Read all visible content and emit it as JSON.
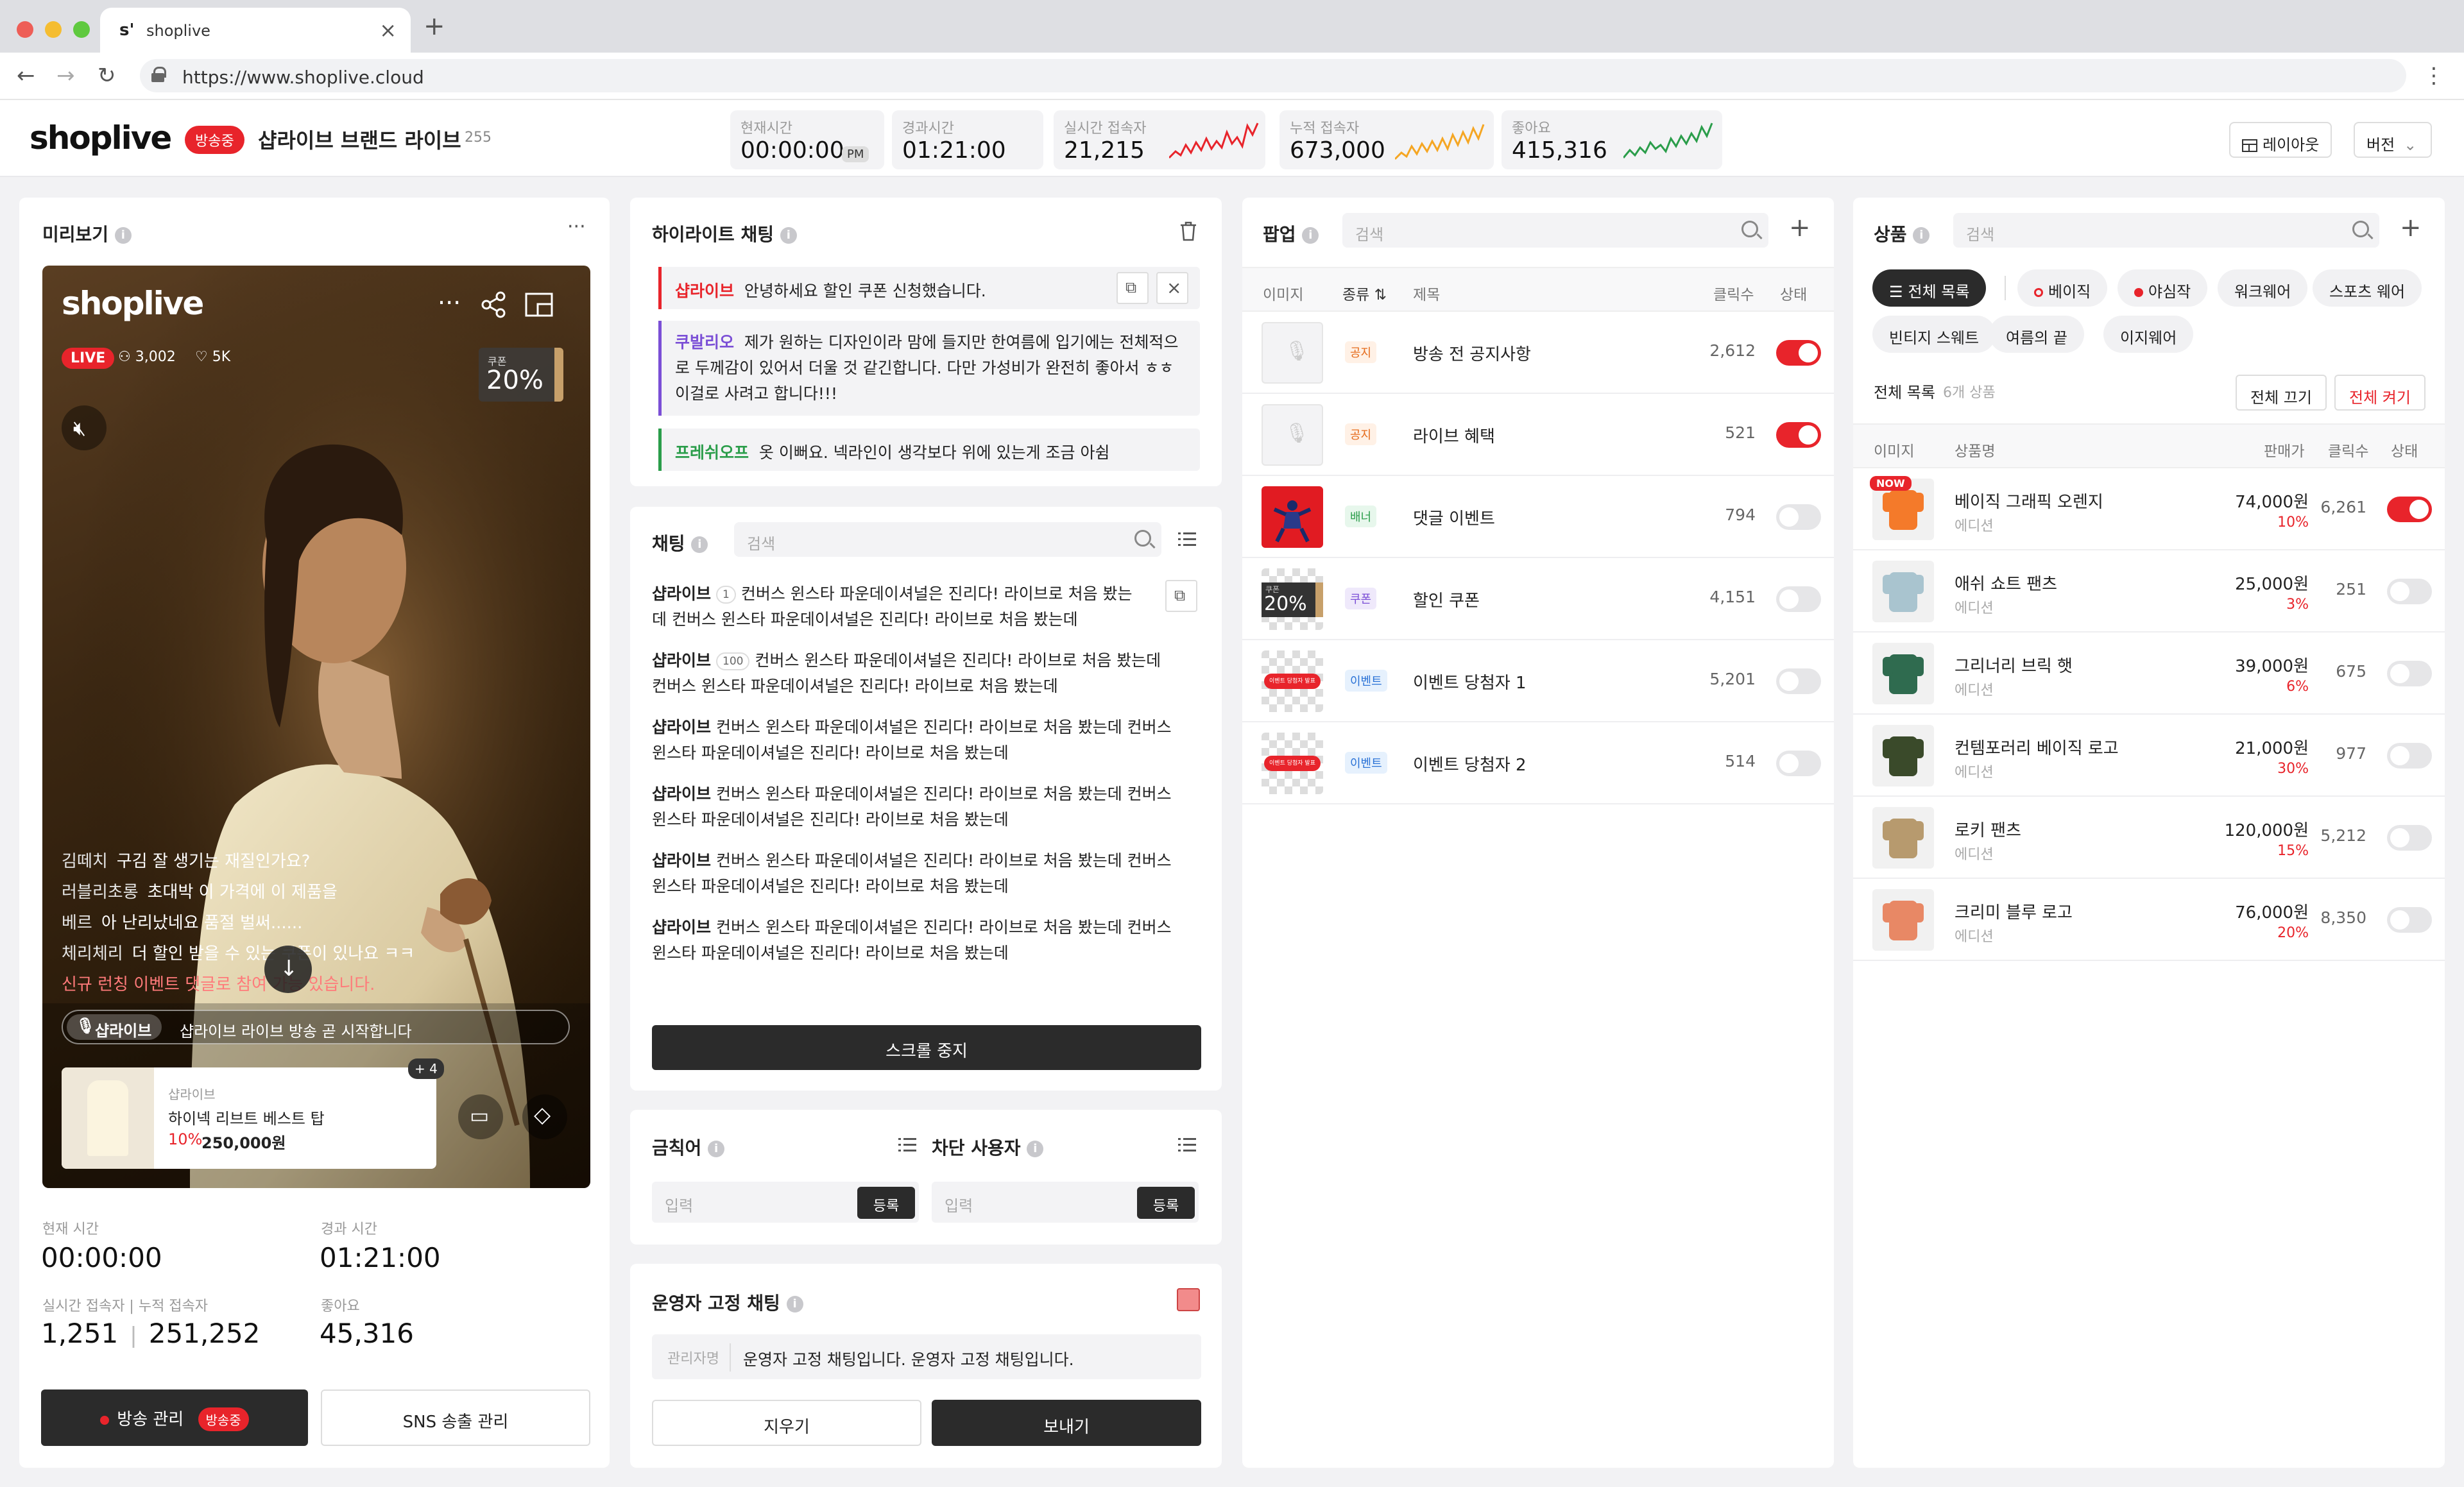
{
  "browser": {
    "tab_title": "shoplive",
    "favicon": "s'",
    "url": "https://www.shoplive.cloud"
  },
  "header": {
    "logo": "shoplive",
    "live_badge": "방송중",
    "title": "샵라이브 브랜드 라이브",
    "view_count": "255",
    "stats": [
      {
        "label": "현재시간",
        "value": "00:00:00",
        "suffix": "PM"
      },
      {
        "label": "경과시간",
        "value": "01:21:00"
      },
      {
        "label": "실시간 접속자",
        "value": "21,215"
      },
      {
        "label": "누적 접속자",
        "value": "673,000"
      },
      {
        "label": "좋아요",
        "value": "415,316"
      }
    ],
    "layout_button": "레이아웃",
    "version_button": "버전",
    "colors": {
      "red": "#e8242b",
      "orange": "#f5a623",
      "green": "#2a9d4a"
    }
  },
  "preview": {
    "title": "미리보기",
    "video": {
      "logo": "shoplive",
      "live": "LIVE",
      "viewers": "3,002",
      "likes": "5K",
      "coupon_label": "쿠폰",
      "coupon_value": "20%",
      "chats": [
        {
          "name": "김떼치",
          "text": "구김 잘 생기는 재질인가요?"
        },
        {
          "name": "러블리초롱",
          "text": "초대박 이 가격에 이 제품을"
        },
        {
          "name": "베르",
          "text": "아 난리났네요 품절 벌써......"
        },
        {
          "name": "체리체리",
          "text": "더 할인 받을 수 있는 쿠폰이 있나요 ㅋㅋ"
        },
        {
          "name": "",
          "text": "신규 런칭 이벤트 댓글로 참여 가능 있습니다."
        }
      ],
      "pinned_name": "샵라이브",
      "pinned_text": "샵라이브 라이브 방송 곧 시작합니다",
      "product_brand": "샵라이브",
      "product_name": "하이넥 리브트 베스트 탑",
      "product_discount": "10%",
      "product_price": "250,000원",
      "more_count": "+ 4"
    },
    "stats": {
      "current_label": "현재 시간",
      "current_value": "00:00:00",
      "elapsed_label": "경과 시간",
      "elapsed_value": "01:21:00",
      "viewers_label": "실시간 접속자 | 누적 접속자",
      "viewers_value": "1,251",
      "total_value": "251,252",
      "likes_label": "좋아요",
      "likes_value": "45,316"
    },
    "broadcast_button": "방송 관리",
    "broadcast_badge": "방송중",
    "sns_button": "SNS 송출 관리"
  },
  "highlight": {
    "title": "하이라이트 채팅",
    "items": [
      {
        "name": "샵라이브",
        "text": "안녕하세요 할인 쿠폰 신청했습니다.",
        "color": "#e8242b"
      },
      {
        "name": "쿠발리오",
        "text": "제가 원하는 디자인이라 맘에 들지만 한여름에 입기에는 전체적으로 두께감이 있어서 더울 것 같긴합니다. 다만 가성비가 완전히 좋아서 ㅎㅎ 이걸로 사려고 합니다!!!",
        "color": "#7b4fd6"
      },
      {
        "name": "프레쉬오프",
        "text": "옷 이뻐요. 넥라인이 생각보다 위에 있는게 조금 아쉼",
        "color": "#2a9d4a"
      }
    ]
  },
  "chat": {
    "title": "채팅",
    "search_placeholder": "검색",
    "messages": [
      {
        "name": "샵라이브",
        "count": "1",
        "text": "컨버스 윈스타 파운데이셔널은 진리다! 라이브로 처음 봤는데 컨버스 윈스타 파운데이셔널은 진리다! 라이브로 처음 봤는데"
      },
      {
        "name": "샵라이브",
        "count": "100",
        "text": "컨버스 윈스타 파운데이셔널은 진리다! 라이브로 처음 봤는데 컨버스 윈스타 파운데이셔널은 진리다! 라이브로 처음 봤는데"
      },
      {
        "name": "샵라이브",
        "count": "",
        "text": "컨버스 윈스타 파운데이셔널은 진리다! 라이브로 처음 봤는데 컨버스 윈스타 파운데이셔널은 진리다! 라이브로 처음 봤는데"
      },
      {
        "name": "샵라이브",
        "count": "",
        "text": "컨버스 윈스타 파운데이셔널은 진리다! 라이브로 처음 봤는데 컨버스 윈스타 파운데이셔널은 진리다! 라이브로 처음 봤는데"
      },
      {
        "name": "샵라이브",
        "count": "",
        "text": "컨버스 윈스타 파운데이셔널은 진리다! 라이브로 처음 봤는데 컨버스 윈스타 파운데이셔널은 진리다! 라이브로 처음 봤는데"
      },
      {
        "name": "샵라이브",
        "count": "",
        "text": "컨버스 윈스타 파운데이셔널은 진리다! 라이브로 처음 봤는데 컨버스 윈스타 파운데이셔널은 진리다! 라이브로 처음 봤는데"
      }
    ],
    "stop_scroll": "스크롤 중지"
  },
  "banned": {
    "title": "금칙어",
    "placeholder": "입력",
    "button": "등록",
    "blocked_title": "차단 사용자",
    "blocked_placeholder": "입력",
    "blocked_button": "등록"
  },
  "admin_chat": {
    "title": "운영자 고정 채팅",
    "color": "#f28b8b",
    "prefix": "관리자명",
    "text": "운영자 고정 채팅입니다. 운영자 고정 채팅입니다.",
    "clear_button": "지우기",
    "send_button": "보내기"
  },
  "popup": {
    "title": "팝업",
    "search_placeholder": "검색",
    "columns": {
      "image": "이미지",
      "type": "종류",
      "title": "제목",
      "clicks": "클릭수",
      "status": "상태"
    },
    "rows": [
      {
        "type": "공지",
        "title": "방송 전 공지사항",
        "clicks": "2,612",
        "on": true,
        "thumb": "mic"
      },
      {
        "type": "공지",
        "title": "라이브 혜택",
        "clicks": "521",
        "on": true,
        "thumb": "mic"
      },
      {
        "type": "배너",
        "title": "댓글 이벤트",
        "clicks": "794",
        "on": false,
        "thumb": "banner"
      },
      {
        "type": "쿠폰",
        "title": "할인 쿠폰",
        "clicks": "4,151",
        "on": false,
        "thumb": "coupon",
        "thumb_label": "쿠폰",
        "thumb_value": "20%"
      },
      {
        "type": "이벤트",
        "title": "이벤트 당첨자 1",
        "clicks": "5,201",
        "on": false,
        "thumb": "event",
        "thumb_label": "이벤트 당첨자 발표"
      },
      {
        "type": "이벤트",
        "title": "이벤트 당첨자 2",
        "clicks": "514",
        "on": false,
        "thumb": "event",
        "thumb_label": "이벤트 당첨자 발표"
      }
    ]
  },
  "products": {
    "title": "상품",
    "search_placeholder": "검색",
    "chips": [
      "전체 목록",
      "베이직",
      "야심작",
      "워크웨어",
      "스포츠 웨어",
      "빈티지 스웨트",
      "여름의 끝",
      "이지웨어"
    ],
    "list_label": "전체 목록",
    "list_count": "6개 상품",
    "all_off": "전체 끄기",
    "all_on": "전체 켜기",
    "columns": {
      "image": "이미지",
      "name": "상품명",
      "price": "판매가",
      "clicks": "클릭수",
      "status": "상태"
    },
    "now_badge": "NOW",
    "rows": [
      {
        "name": "베이직 그래픽 오렌지",
        "brand": "에디션",
        "price": "74,000원",
        "discount": "10%",
        "clicks": "6,261",
        "on": true,
        "color": "#f47a2a"
      },
      {
        "name": "애쉬 쇼트 팬츠",
        "brand": "에디션",
        "price": "25,000원",
        "discount": "3%",
        "clicks": "251",
        "on": false,
        "color": "#a9c4cf"
      },
      {
        "name": "그리너리 브릭 햇",
        "brand": "에디션",
        "price": "39,000원",
        "discount": "6%",
        "clicks": "675",
        "on": false,
        "color": "#2f6b4f"
      },
      {
        "name": "컨템포러리 베이직 로고",
        "brand": "에디션",
        "price": "21,000원",
        "discount": "30%",
        "clicks": "977",
        "on": false,
        "color": "#3a4a2a"
      },
      {
        "name": "로키 팬츠",
        "brand": "에디션",
        "price": "120,000원",
        "discount": "15%",
        "clicks": "5,212",
        "on": false,
        "color": "#b79a6e"
      },
      {
        "name": "크리미 블루 로고",
        "brand": "에디션",
        "price": "76,000원",
        "discount": "20%",
        "clicks": "8,350",
        "on": false,
        "color": "#e88865"
      }
    ]
  }
}
